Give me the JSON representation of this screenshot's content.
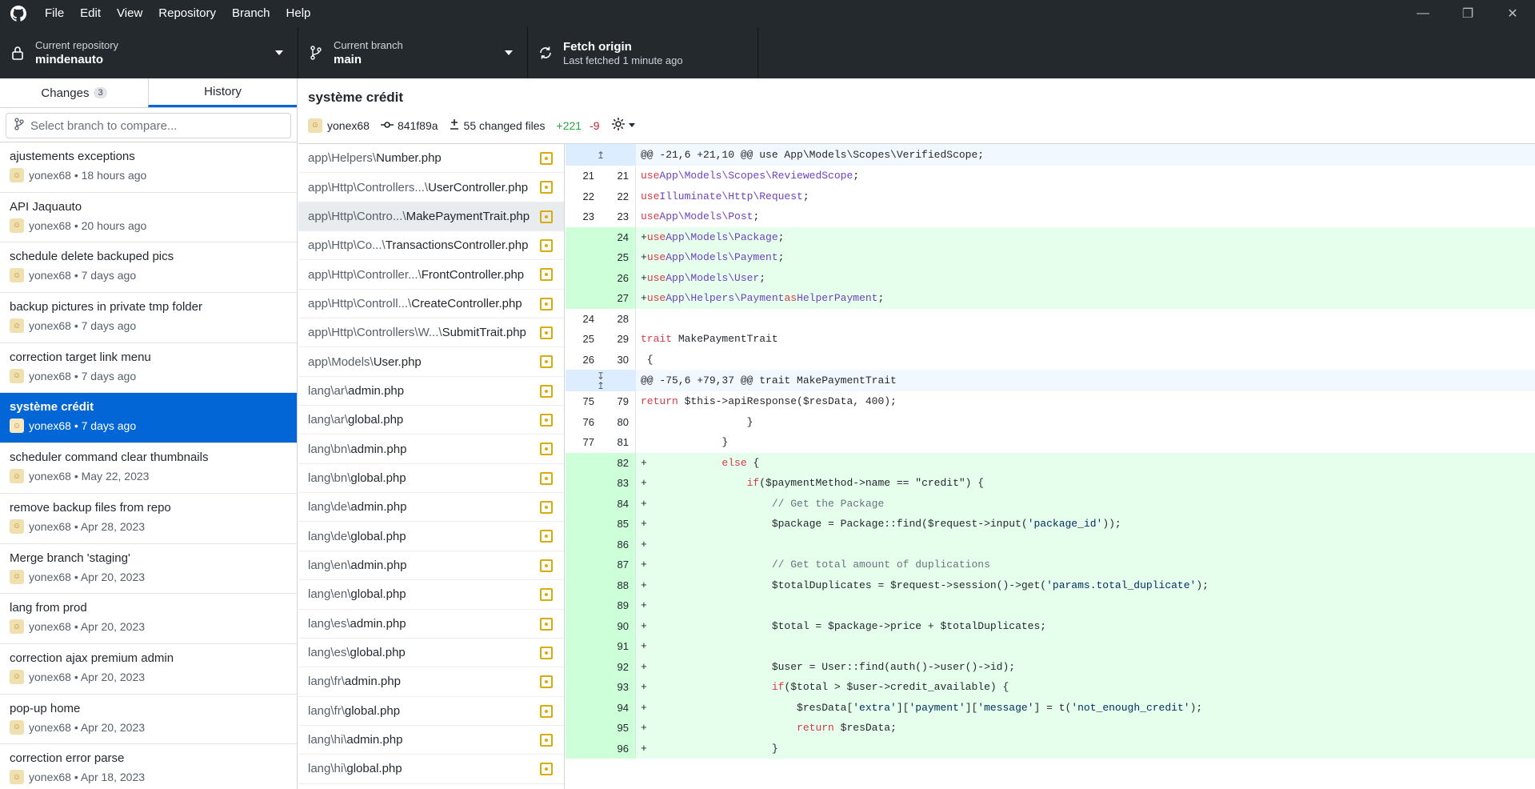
{
  "menu": [
    "File",
    "Edit",
    "View",
    "Repository",
    "Branch",
    "Help"
  ],
  "toolbar": {
    "repo_label": "Current repository",
    "repo_value": "mindenauto",
    "branch_label": "Current branch",
    "branch_value": "main",
    "fetch_label": "Fetch origin",
    "fetch_sub": "Last fetched 1 minute ago"
  },
  "tabs": {
    "changes": "Changes",
    "changes_count": "3",
    "history": "History"
  },
  "compare": {
    "placeholder": "Select branch to compare..."
  },
  "commits": [
    {
      "title": "ajustements exceptions",
      "meta": "yonex68 • 18 hours ago"
    },
    {
      "title": "API Jaquauto",
      "meta": "yonex68 • 20 hours ago"
    },
    {
      "title": "schedule delete backuped pics",
      "meta": "yonex68 • 7 days ago"
    },
    {
      "title": "backup pictures in private tmp folder",
      "meta": "yonex68 • 7 days ago"
    },
    {
      "title": "correction target link menu",
      "meta": "yonex68 • 7 days ago"
    },
    {
      "title": "système crédit",
      "meta": "yonex68 • 7 days ago",
      "selected": true
    },
    {
      "title": "scheduler command clear thumbnails",
      "meta": "yonex68 • May 22, 2023"
    },
    {
      "title": "remove backup files from repo",
      "meta": "yonex68 • Apr 28, 2023"
    },
    {
      "title": "Merge branch 'staging'",
      "meta": "yonex68 • Apr 20, 2023"
    },
    {
      "title": "lang from prod",
      "meta": "yonex68 • Apr 20, 2023"
    },
    {
      "title": "correction ajax premium admin",
      "meta": "yonex68 • Apr 20, 2023"
    },
    {
      "title": "pop-up home",
      "meta": "yonex68 • Apr 20, 2023"
    },
    {
      "title": "correction error parse",
      "meta": "yonex68 • Apr 18, 2023"
    }
  ],
  "header": {
    "summary": "système crédit",
    "author": "yonex68",
    "sha": "841f89a",
    "changed": "55 changed files",
    "additions": "+221",
    "deletions": "-9"
  },
  "files": [
    {
      "dir": "app\\Helpers\\",
      "name": "Number.php"
    },
    {
      "dir": "app\\Http\\Controllers...\\",
      "name": "UserController.php"
    },
    {
      "dir": "app\\Http\\Contro...\\",
      "name": "MakePaymentTrait.php",
      "selected": true
    },
    {
      "dir": "app\\Http\\Co...\\",
      "name": "TransactionsController.php"
    },
    {
      "dir": "app\\Http\\Controller...\\",
      "name": "FrontController.php"
    },
    {
      "dir": "app\\Http\\Controll...\\",
      "name": "CreateController.php"
    },
    {
      "dir": "app\\Http\\Controllers\\W...\\",
      "name": "SubmitTrait.php"
    },
    {
      "dir": "app\\Models\\",
      "name": "User.php"
    },
    {
      "dir": "lang\\ar\\",
      "name": "admin.php"
    },
    {
      "dir": "lang\\ar\\",
      "name": "global.php"
    },
    {
      "dir": "lang\\bn\\",
      "name": "admin.php"
    },
    {
      "dir": "lang\\bn\\",
      "name": "global.php"
    },
    {
      "dir": "lang\\de\\",
      "name": "admin.php"
    },
    {
      "dir": "lang\\de\\",
      "name": "global.php"
    },
    {
      "dir": "lang\\en\\",
      "name": "admin.php"
    },
    {
      "dir": "lang\\en\\",
      "name": "global.php"
    },
    {
      "dir": "lang\\es\\",
      "name": "admin.php"
    },
    {
      "dir": "lang\\es\\",
      "name": "global.php"
    },
    {
      "dir": "lang\\fr\\",
      "name": "admin.php"
    },
    {
      "dir": "lang\\fr\\",
      "name": "global.php"
    },
    {
      "dir": "lang\\hi\\",
      "name": "admin.php"
    },
    {
      "dir": "lang\\hi\\",
      "name": "global.php"
    }
  ],
  "diff": [
    {
      "t": "hunk",
      "a": "",
      "b": "",
      "text": "@@ -21,6 +21,10 @@ use App\\Models\\Scopes\\VerifiedScope;",
      "exp": "up"
    },
    {
      "t": "ctx",
      "a": "21",
      "b": "21",
      "text": " use App\\Models\\Scopes\\ReviewedScope;"
    },
    {
      "t": "ctx",
      "a": "22",
      "b": "22",
      "text": " use Illuminate\\Http\\Request;"
    },
    {
      "t": "ctx",
      "a": "23",
      "b": "23",
      "text": " use App\\Models\\Post;"
    },
    {
      "t": "add",
      "a": "",
      "b": "24",
      "text": "+use App\\Models\\Package;"
    },
    {
      "t": "add",
      "a": "",
      "b": "25",
      "text": "+use App\\Models\\Payment;"
    },
    {
      "t": "add",
      "a": "",
      "b": "26",
      "text": "+use App\\Models\\User;"
    },
    {
      "t": "add",
      "a": "",
      "b": "27",
      "text": "+use App\\Helpers\\Payment as HelperPayment;"
    },
    {
      "t": "ctx",
      "a": "24",
      "b": "28",
      "text": ""
    },
    {
      "t": "ctx",
      "a": "25",
      "b": "29",
      "text": " trait MakePaymentTrait"
    },
    {
      "t": "ctx",
      "a": "26",
      "b": "30",
      "text": " {"
    },
    {
      "t": "hunk",
      "a": "",
      "b": "",
      "text": "@@ -75,6 +79,37 @@ trait MakePaymentTrait",
      "exp": "both"
    },
    {
      "t": "ctx",
      "a": "75",
      "b": "79",
      "text": "                     return $this->apiResponse($resData, 400);"
    },
    {
      "t": "ctx",
      "a": "76",
      "b": "80",
      "text": "                 }"
    },
    {
      "t": "ctx",
      "a": "77",
      "b": "81",
      "text": "             }"
    },
    {
      "t": "add",
      "a": "",
      "b": "82",
      "text": "+            else {"
    },
    {
      "t": "add",
      "a": "",
      "b": "83",
      "text": "+                if($paymentMethod->name == \"credit\") {"
    },
    {
      "t": "add",
      "a": "",
      "b": "84",
      "text": "+                    // Get the Package"
    },
    {
      "t": "add",
      "a": "",
      "b": "85",
      "text": "+                    $package = Package::find($request->input('package_id'));"
    },
    {
      "t": "add",
      "a": "",
      "b": "86",
      "text": "+"
    },
    {
      "t": "add",
      "a": "",
      "b": "87",
      "text": "+                    // Get total amount of duplications"
    },
    {
      "t": "add",
      "a": "",
      "b": "88",
      "text": "+                    $totalDuplicates = $request->session()->get('params.total_duplicate');"
    },
    {
      "t": "add",
      "a": "",
      "b": "89",
      "text": "+"
    },
    {
      "t": "add",
      "a": "",
      "b": "90",
      "text": "+                    $total = $package->price + $totalDuplicates;"
    },
    {
      "t": "add",
      "a": "",
      "b": "91",
      "text": "+"
    },
    {
      "t": "add",
      "a": "",
      "b": "92",
      "text": "+                    $user = User::find(auth()->user()->id);"
    },
    {
      "t": "add",
      "a": "",
      "b": "93",
      "text": "+                    if($total > $user->credit_available) {"
    },
    {
      "t": "add",
      "a": "",
      "b": "94",
      "text": "+                        $resData['extra']['payment']['message'] = t('not_enough_credit');"
    },
    {
      "t": "add",
      "a": "",
      "b": "95",
      "text": "+                        return $resData;"
    },
    {
      "t": "add",
      "a": "",
      "b": "96",
      "text": "+                    }"
    }
  ]
}
